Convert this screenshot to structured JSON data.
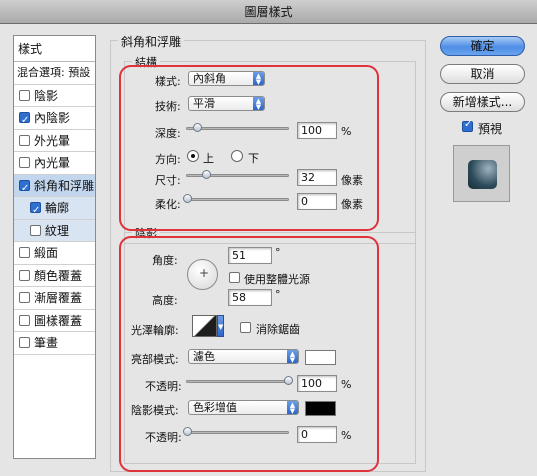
{
  "window": {
    "title": "圖層樣式"
  },
  "styles_list": {
    "header": "樣式",
    "blending": "混合選項: 預設",
    "items": [
      {
        "label": "陰影",
        "checked": false
      },
      {
        "label": "內陰影",
        "checked": true
      },
      {
        "label": "外光暈",
        "checked": false
      },
      {
        "label": "內光暈",
        "checked": false
      },
      {
        "label": "斜角和浮雕",
        "checked": true,
        "selected": true
      },
      {
        "label": "輪廓",
        "checked": true,
        "sub": true
      },
      {
        "label": "紋理",
        "checked": false,
        "sub": true
      },
      {
        "label": "緞面",
        "checked": false
      },
      {
        "label": "顏色覆蓋",
        "checked": false
      },
      {
        "label": "漸層覆蓋",
        "checked": false
      },
      {
        "label": "圖樣覆蓋",
        "checked": false
      },
      {
        "label": "筆畫",
        "checked": false
      }
    ]
  },
  "panel": {
    "title": "斜角和浮雕",
    "structure": {
      "title": "結構",
      "style_label": "樣式:",
      "style_value": "內斜角",
      "technique_label": "技術:",
      "technique_value": "平滑",
      "depth_label": "深度:",
      "depth_value": "100",
      "depth_unit": "%",
      "direction_label": "方向:",
      "dir_up": "上",
      "dir_down": "下",
      "dir_selected": "上",
      "size_label": "尺寸:",
      "size_value": "32",
      "size_unit": "像素",
      "soften_label": "柔化:",
      "soften_value": "0",
      "soften_unit": "像素"
    },
    "shading": {
      "title": "陰影",
      "angle_label": "角度:",
      "angle_value": "51",
      "angle_unit": "°",
      "global_light_label": "使用整體光源",
      "global_light_checked": false,
      "altitude_label": "高度:",
      "altitude_value": "58",
      "altitude_unit": "°",
      "gloss_label": "光澤輪廓:",
      "antialias_label": "消除鋸齒",
      "antialias_checked": false,
      "highlight_mode_label": "亮部模式:",
      "highlight_mode_value": "濾色",
      "highlight_color": "#ffffff",
      "highlight_opacity_label": "不透明:",
      "highlight_opacity_value": "100",
      "highlight_opacity_unit": "%",
      "shadow_mode_label": "陰影模式:",
      "shadow_mode_value": "色彩增值",
      "shadow_color": "#000000",
      "shadow_opacity_label": "不透明:",
      "shadow_opacity_value": "0",
      "shadow_opacity_unit": "%"
    }
  },
  "buttons": {
    "ok": "確定",
    "cancel": "取消",
    "new_style": "新增樣式...",
    "preview_label": "預視",
    "preview_checked": true
  },
  "colors": {
    "accent": "#2f6fd0",
    "highlight_box": "#e0323a"
  }
}
